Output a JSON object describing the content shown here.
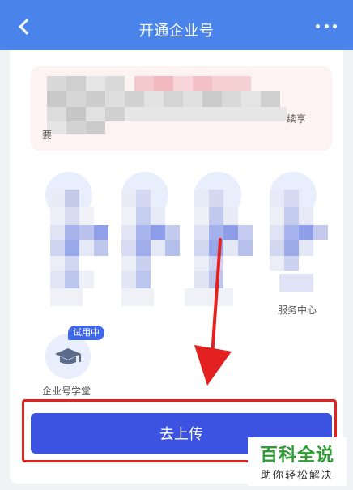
{
  "header": {
    "title": "开通企业号",
    "back_icon": "chevron-left-icon",
    "more_icon": "more-dots-icon"
  },
  "notice": {
    "visible_tail": "续享",
    "visible_head": "要"
  },
  "features": {
    "service_center_label": "服务中心",
    "academy_label": "企业号学堂",
    "academy_badge": "试用中"
  },
  "upload_button": {
    "label": "去上传"
  },
  "watermark": {
    "main": "百科全说",
    "sub": "助你轻松解决"
  },
  "colors": {
    "header_bg": "#4a83ea",
    "button_bg": "#3c52e0",
    "highlight": "#e32121",
    "watermark_green": "#2e9b34"
  }
}
